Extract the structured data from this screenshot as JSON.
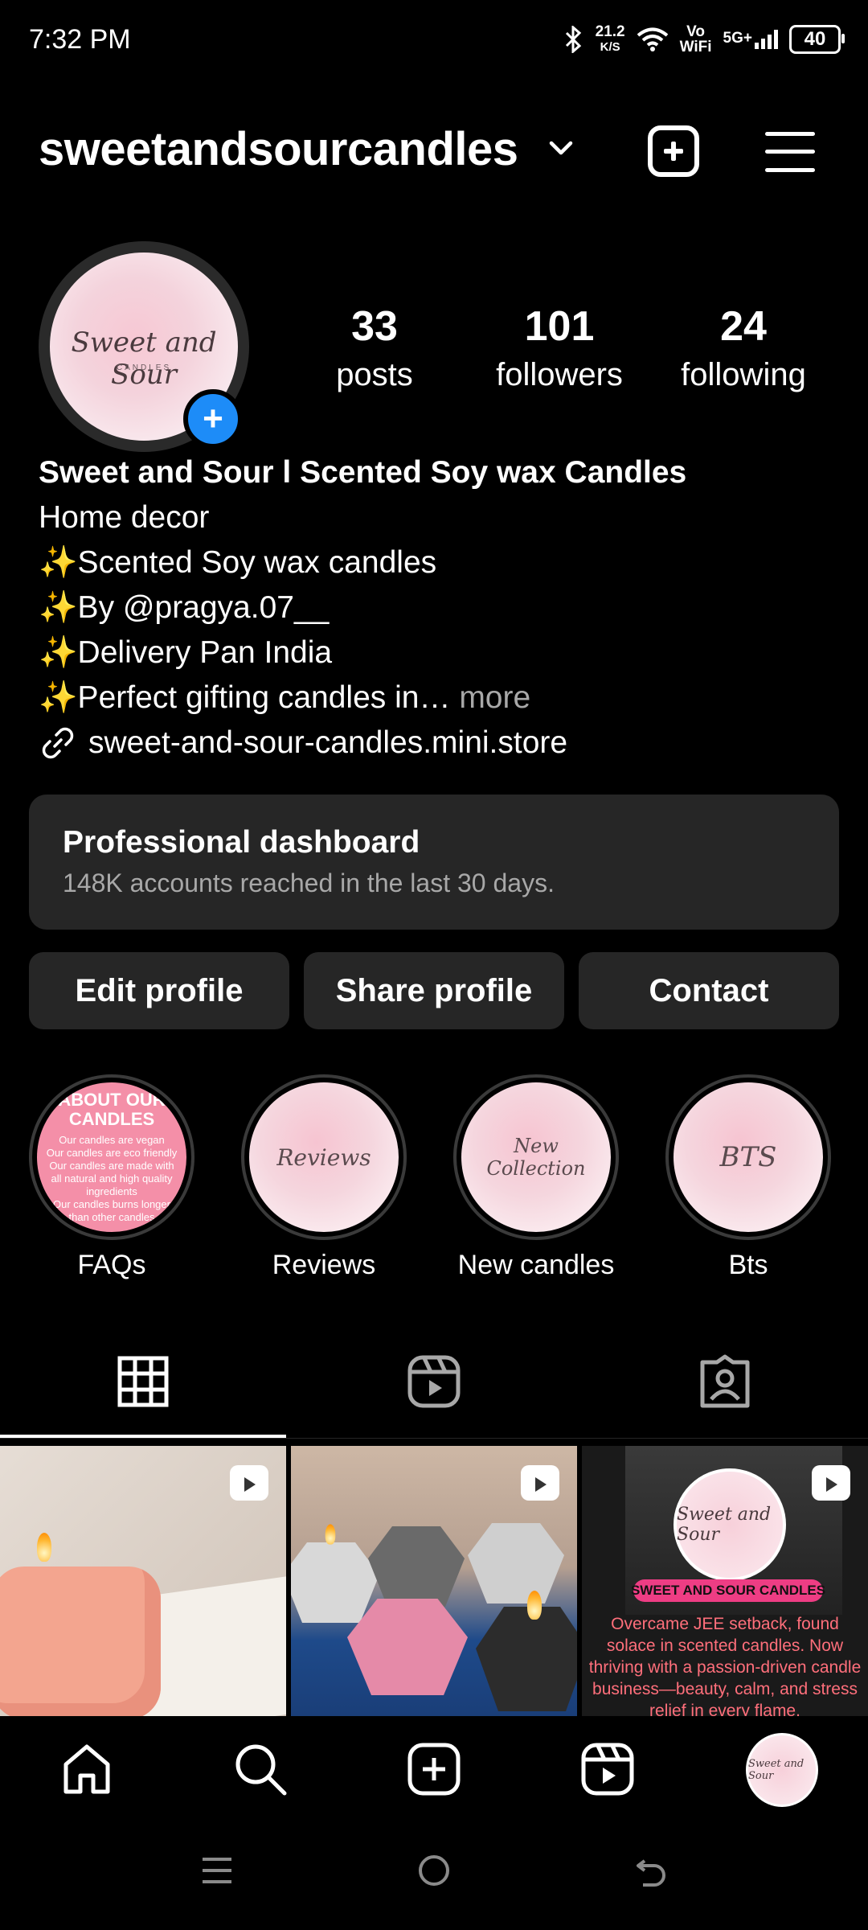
{
  "status_bar": {
    "time": "7:32 PM",
    "net_speed_value": "21.2",
    "net_speed_unit": "K/S",
    "vowifi_top": "Vo",
    "vowifi_bottom": "WiFi",
    "signal_label": "5G+",
    "battery": "40"
  },
  "header": {
    "username": "sweetandsourcandles",
    "icons": [
      "chevron-down-icon",
      "create-icon",
      "menu-icon"
    ]
  },
  "profile": {
    "avatar_text": "Sweet and Sour",
    "avatar_subtext": "CANDLES",
    "add_story": "+",
    "stats": [
      {
        "value": "33",
        "label": "posts"
      },
      {
        "value": "101",
        "label": "followers"
      },
      {
        "value": "24",
        "label": "following"
      }
    ]
  },
  "bio": {
    "name": "Sweet and Sour l Scented Soy wax Candles",
    "category": "Home decor",
    "lines": [
      "✨Scented Soy wax candles",
      "✨By @pragya.07__",
      "✨Delivery Pan India",
      "✨Perfect gifting candles in…"
    ],
    "more": "more",
    "link": "sweet-and-sour-candles.mini.store"
  },
  "dashboard": {
    "title": "Professional dashboard",
    "subtitle": "148K accounts reached in the last 30 days."
  },
  "actions": {
    "edit": "Edit profile",
    "share": "Share profile",
    "contact": "Contact"
  },
  "highlights": [
    {
      "label": "FAQs",
      "cover_title": "ABOUT OUR CANDLES",
      "cover_lines": [
        "Our candles are vegan",
        "Our candles are eco friendly",
        "Our candles are made with all natural and high quality ingredients",
        "Our candles burns longer than other candles"
      ]
    },
    {
      "label": "Reviews",
      "cover_title": "Reviews"
    },
    {
      "label": "New candles",
      "cover_title": "New Collection"
    },
    {
      "label": "Bts",
      "cover_title": "BTS"
    }
  ],
  "tabs": [
    "grid-icon",
    "reels-icon",
    "tagged-icon"
  ],
  "posts": [
    {
      "type": "reel"
    },
    {
      "type": "reel"
    },
    {
      "type": "reel",
      "logo_text": "Sweet and Sour",
      "banner": "SWEET AND SOUR CANDLES",
      "caption": "Overcame JEE setback, found solace in scented candles. Now thriving with a passion-driven candle business—beauty, calm, and stress relief in every flame."
    }
  ],
  "bottom_nav": [
    "home-icon",
    "search-icon",
    "create-icon",
    "reels-icon",
    "profile-avatar"
  ],
  "bottom_nav_avatar_text": "Sweet and Sour",
  "colors": {
    "background": "#000000",
    "surface": "#262626",
    "accent": "#1d8cf8",
    "muted": "#a8a8a8"
  }
}
